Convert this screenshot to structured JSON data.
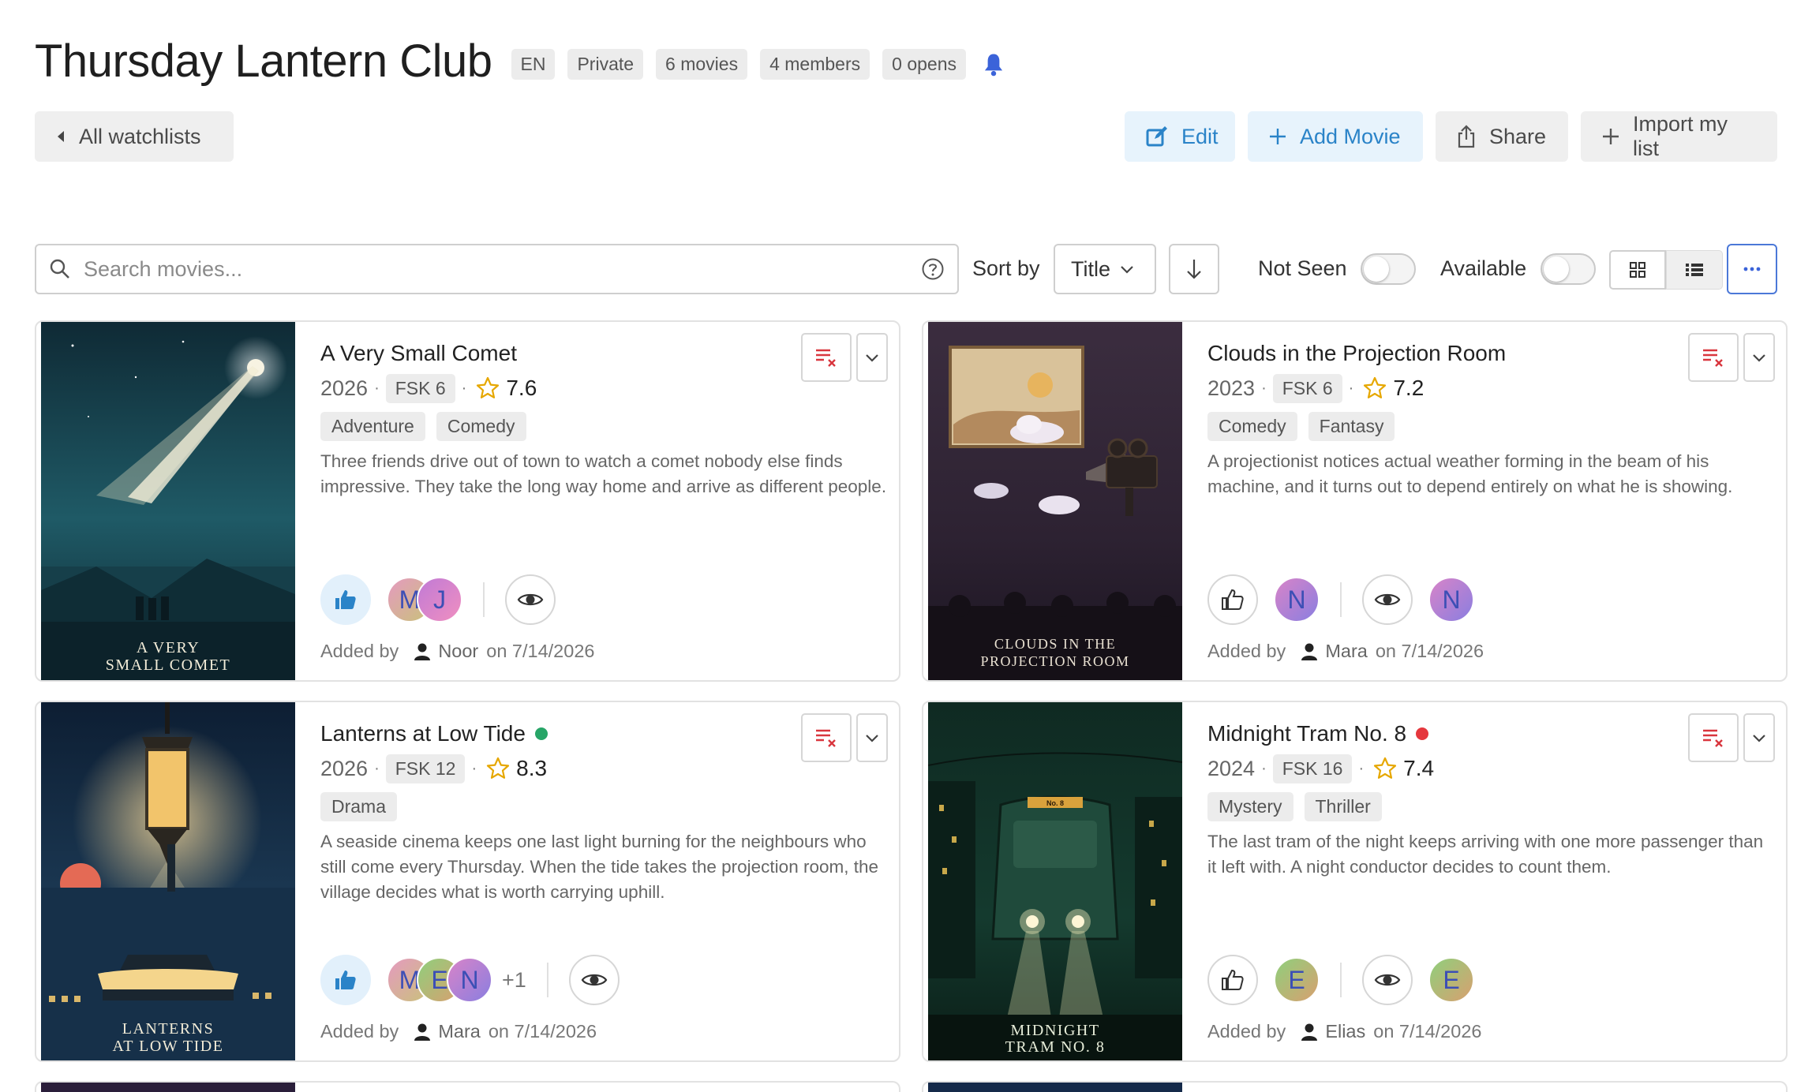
{
  "header": {
    "title": "Thursday Lantern Club",
    "badges": {
      "language": "EN",
      "visibility": "Private",
      "movies": "6 movies",
      "members": "4 members",
      "opens": "0 opens"
    }
  },
  "toolbar": {
    "back_label": "All watchlists",
    "edit_label": "Edit",
    "add_movie_label": "Add Movie",
    "share_label": "Share",
    "import_label": "Import my list"
  },
  "filters": {
    "search_placeholder": "Search movies...",
    "sort_label": "Sort by",
    "sort_value": "Title",
    "not_seen_label": "Not Seen",
    "available_label": "Available"
  },
  "colors": {
    "accent_blue": "#2a83c8",
    "available_dot": "#27a567",
    "unavailable_dot": "#e5373d",
    "remove_icon": "#d9363e"
  },
  "movies": [
    {
      "title": "A Very Small Comet",
      "year": "2026",
      "fsk": "FSK 6",
      "rating": "7.6",
      "genres": [
        "Adventure",
        "Comedy"
      ],
      "description": "Three friends drive out of town to watch a comet nobody else finds impressive. They take the long way home and arrive as different people.",
      "poster_line1": "A VERY",
      "poster_line2": "SMALL COMET",
      "liked": true,
      "likes_avatars": [
        "M",
        "J"
      ],
      "likes_extra": "",
      "seen_avatars": [],
      "added_by_label": "Added by",
      "added_by": "Noor",
      "added_on": "on 7/14/2026"
    },
    {
      "title": "Clouds in the Projection Room",
      "year": "2023",
      "fsk": "FSK 6",
      "rating": "7.2",
      "genres": [
        "Comedy",
        "Fantasy"
      ],
      "description": "A projectionist notices actual weather forming in the beam of his machine, and it turns out to depend entirely on what he is showing.",
      "poster_line1": "CLOUDS IN THE",
      "poster_line2": "PROJECTION ROOM",
      "liked": false,
      "likes_avatars": [
        "N"
      ],
      "likes_extra": "",
      "seen_avatars": [
        "N"
      ],
      "added_by_label": "Added by",
      "added_by": "Mara",
      "added_on": "on 7/14/2026"
    },
    {
      "title": "Lanterns at Low Tide",
      "year": "2026",
      "fsk": "FSK 12",
      "rating": "8.3",
      "genres": [
        "Drama"
      ],
      "description": "A seaside cinema keeps one last light burning for the neighbours who still come every Thursday. When the tide takes the projection room, the village decides what is worth carrying uphill.",
      "poster_line1": "LANTERNS",
      "poster_line2": "AT LOW TIDE",
      "liked": true,
      "likes_avatars": [
        "M",
        "E",
        "N"
      ],
      "likes_extra": "+1",
      "seen_avatars": [],
      "added_by_label": "Added by",
      "added_by": "Mara",
      "added_on": "on 7/14/2026"
    },
    {
      "title": "Midnight Tram No. 8",
      "year": "2024",
      "fsk": "FSK 16",
      "rating": "7.4",
      "genres": [
        "Mystery",
        "Thriller"
      ],
      "description": "The last tram of the night keeps arriving with one more passenger than it left with. A night conductor decides to count them.",
      "poster_line1": "MIDNIGHT",
      "poster_line2": "TRAM NO. 8",
      "poster_sign": "No. 8",
      "liked": false,
      "likes_avatars": [
        "E"
      ],
      "likes_extra": "",
      "seen_avatars": [
        "E"
      ],
      "added_by_label": "Added by",
      "added_by": "Elias",
      "added_on": "on 7/14/2026"
    }
  ]
}
